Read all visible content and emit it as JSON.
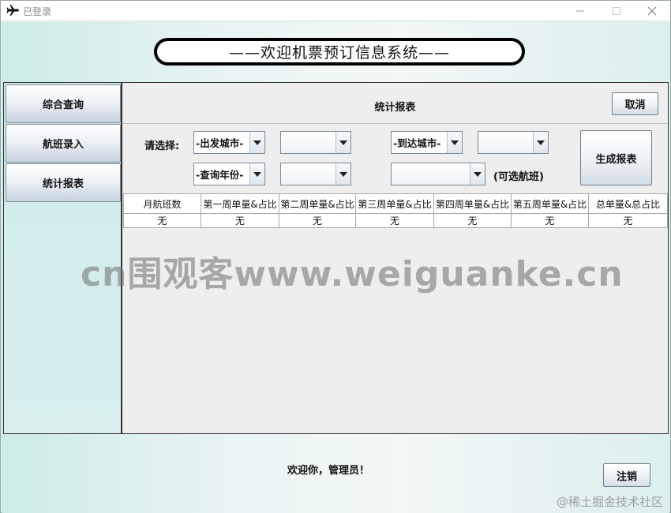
{
  "window": {
    "title": "已登录"
  },
  "banner": {
    "text": "——欢迎机票预订信息系统——"
  },
  "sidebar": {
    "items": [
      {
        "label": "综合查询"
      },
      {
        "label": "航班录入"
      },
      {
        "label": "统计报表"
      }
    ]
  },
  "main": {
    "title": "统计报表",
    "cancel_label": "取消",
    "select_label": "请选择:",
    "departure_city": "-出发城市-",
    "arrival_city": "-到达城市-",
    "query_year": "-查询年份-",
    "optional_flight": "(可选航班)",
    "generate_label": "生成报表"
  },
  "table": {
    "headers": [
      "月航班数",
      "第一周单量&占比",
      "第二周单量&占比",
      "第三周单量&占比",
      "第四周单量&占比",
      "第五周单量&占比",
      "总单量&总占比"
    ],
    "row": [
      "无",
      "无",
      "无",
      "无",
      "无",
      "无",
      "无"
    ]
  },
  "footer": {
    "welcome": "欢迎你，管理员！",
    "logout_label": "注销"
  },
  "overlay": {
    "watermark": "cn围观客www.weiguanke.cn",
    "corner": "@稀土掘金技术社区"
  },
  "colors": {
    "background": "#dfeeee",
    "panel": "#eeeeee",
    "button_gradient_end": "#c6d3df"
  }
}
